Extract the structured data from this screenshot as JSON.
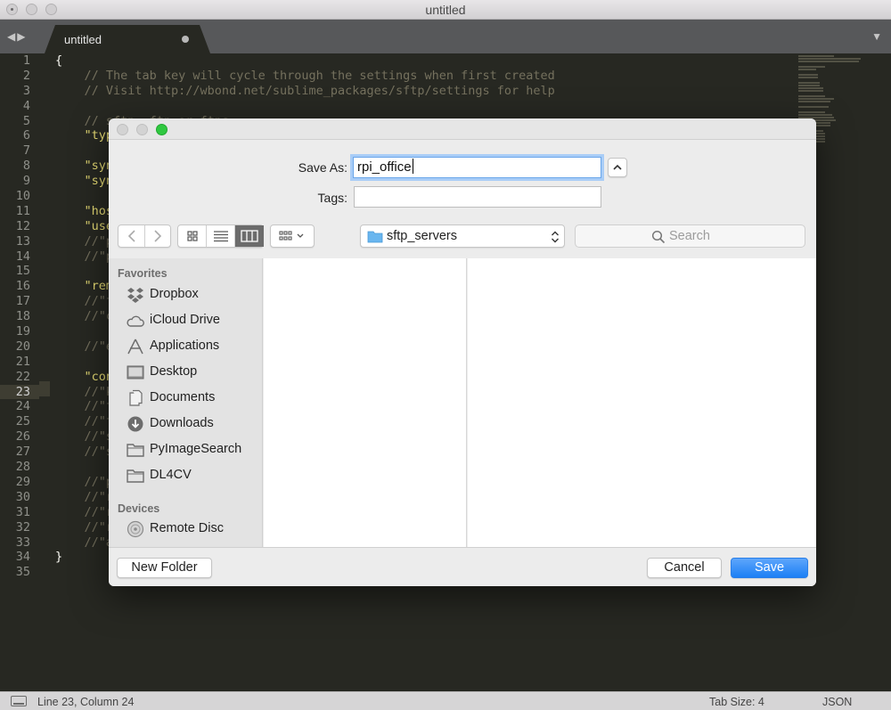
{
  "window": {
    "title": "untitled"
  },
  "tab": {
    "label": "untitled"
  },
  "editor": {
    "line_numbers": [
      "1",
      "2",
      "3",
      "4",
      "5",
      "6",
      "7",
      "8",
      "9",
      "10",
      "11",
      "12",
      "13",
      "14",
      "15",
      "16",
      "17",
      "18",
      "19",
      "20",
      "21",
      "22",
      "23",
      "24",
      "25",
      "26",
      "27",
      "28",
      "29",
      "30",
      "31",
      "32",
      "33",
      "34",
      "35"
    ],
    "lines": [
      "{",
      "    // The tab key will cycle through the settings when first created",
      "    // Visit http://wbond.net/sublime_packages/sftp/settings for help",
      "",
      "    // sftp, ftp or ftps",
      "    \"typ",
      "",
      "    \"syn",
      "    \"syn",
      "",
      "    \"hos",
      "    \"use",
      "    //\"p",
      "    //\"p",
      "",
      "    \"rem",
      "    //\"f",
      "    //\"c",
      "",
      "    //\"e",
      "",
      "    \"con",
      "    //\"k",
      "    //\"f",
      "    //\"f",
      "    //\"s",
      "    //\"s",
      "",
      "    //\"p",
      "    //\"r",
      "    //\"r",
      "    //\"r",
      "    //\"a",
      "}",
      ""
    ]
  },
  "status": {
    "position": "Line 23, Column 24",
    "tab_size": "Tab Size: 4",
    "syntax": "JSON"
  },
  "dialog": {
    "save_as_label": "Save As:",
    "save_as_value": "rpi_office",
    "tags_label": "Tags:",
    "location": "sftp_servers",
    "search_placeholder": "Search",
    "favorites_header": "Favorites",
    "favorites": [
      "Dropbox",
      "iCloud Drive",
      "Applications",
      "Desktop",
      "Documents",
      "Downloads",
      "PyImageSearch",
      "DL4CV"
    ],
    "devices_header": "Devices",
    "devices": [
      "Remote Disc"
    ],
    "new_folder": "New Folder",
    "cancel": "Cancel",
    "save": "Save"
  }
}
